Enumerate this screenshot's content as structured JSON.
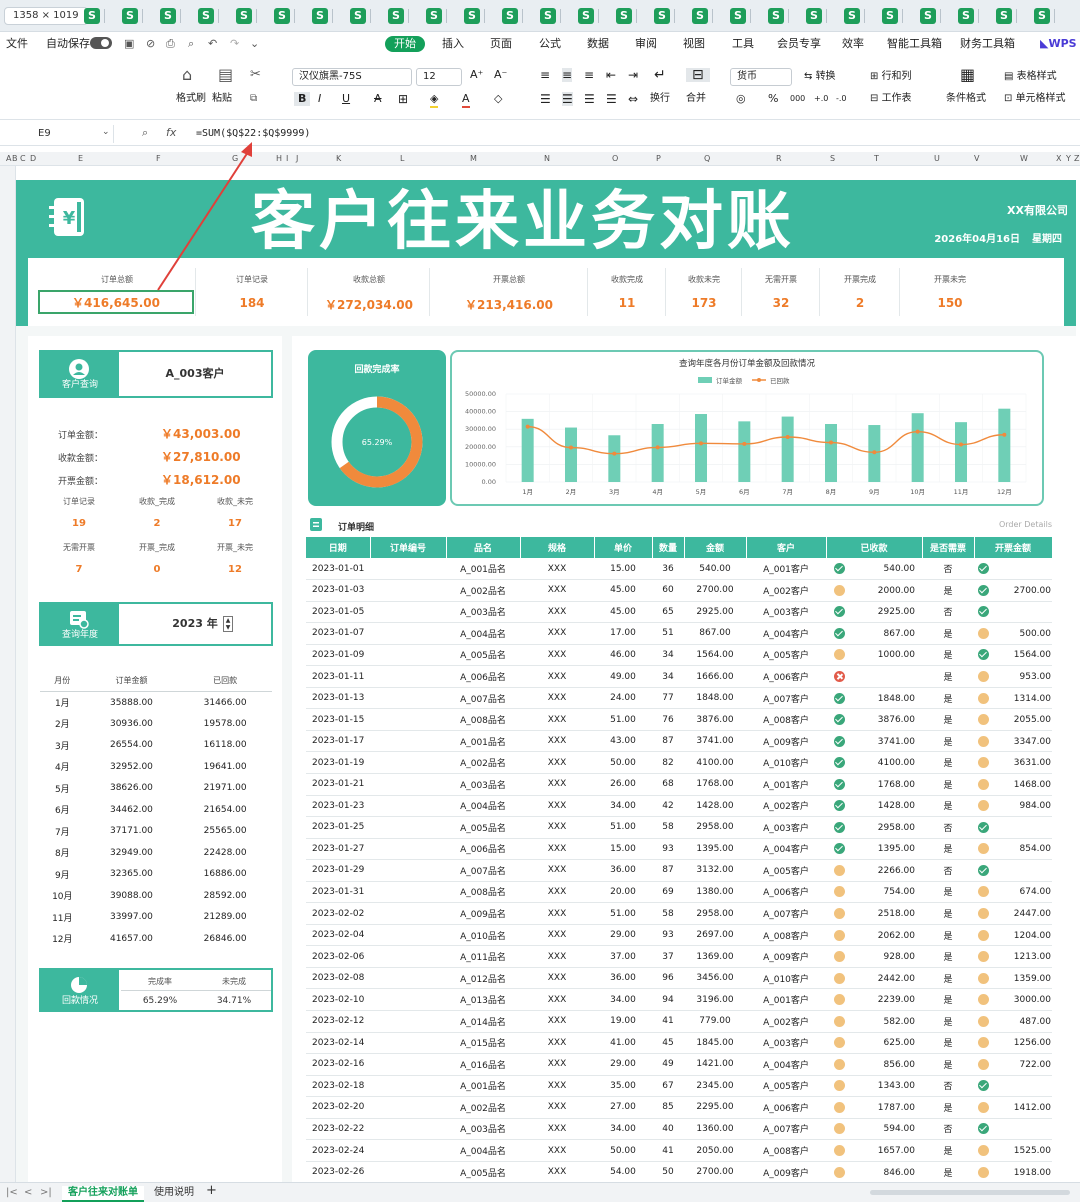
{
  "topbar": {
    "dimensions": "1358 × 1019",
    "sheet_tab_glyph": "S",
    "tab_count": 26
  },
  "menu": {
    "file": "文件",
    "autosave": "自动保存",
    "items": [
      "开始",
      "插入",
      "页面",
      "公式",
      "数据",
      "审阅",
      "视图",
      "工具",
      "会员专享",
      "效率",
      "智能工具箱",
      "财务工具箱"
    ],
    "brand": "WPS"
  },
  "ribbon": {
    "format_painter": "格式刷",
    "paste": "粘贴",
    "font_name": "汉仪旗黑-75S",
    "font_size": "12",
    "wrap": "换行",
    "merge": "合并",
    "number_format": "货币",
    "convert": "转换",
    "row_col": "行和列",
    "worksheet": "工作表",
    "cond_format": "条件格式",
    "table_style": "表格样式",
    "cell_style": "单元格样式"
  },
  "formula": {
    "cell": "E9",
    "fx": "fx",
    "text": "=SUM($Q$22:$Q$9999)"
  },
  "columns": [
    "A",
    "B",
    "C",
    "D",
    "E",
    "F",
    "G",
    "H",
    "I",
    "J",
    "K",
    "L",
    "M",
    "N",
    "O",
    "P",
    "Q",
    "R",
    "S",
    "T",
    "U",
    "V",
    "W",
    "X",
    "Y",
    "Z"
  ],
  "banner": {
    "title": "客户往来业务对账",
    "company": "XX有限公司",
    "date": "2026年04月16日",
    "weekday": "星期四"
  },
  "stats": [
    {
      "label": "订单总额",
      "value": "￥416,645.00"
    },
    {
      "label": "订单记录",
      "value": "184"
    },
    {
      "label": "收款总额",
      "value": "￥272,034.00"
    },
    {
      "label": "开票总额",
      "value": "￥213,416.00"
    },
    {
      "label": "收款完成",
      "value": "11"
    },
    {
      "label": "收款未完",
      "value": "173"
    },
    {
      "label": "无需开票",
      "value": "32"
    },
    {
      "label": "开票完成",
      "value": "2"
    },
    {
      "label": "开票未完",
      "value": "150"
    }
  ],
  "customer": {
    "header": "客户查询",
    "value": "A_003客户",
    "order_label": "订单金额：",
    "order": "￥43,003.00",
    "recv_label": "收款金额：",
    "recv": "￥27,810.00",
    "inv_label": "开票金额：",
    "inv": "￥18,612.00",
    "mini": [
      {
        "label": "订单记录",
        "value": "19"
      },
      {
        "label": "收款_完成",
        "value": "2"
      },
      {
        "label": "收款_未完",
        "value": "17"
      },
      {
        "label": "无需开票",
        "value": "7"
      },
      {
        "label": "开票_完成",
        "value": "0"
      },
      {
        "label": "开票_未完",
        "value": "12"
      }
    ]
  },
  "year": {
    "header": "查询年度",
    "value": "2023 年"
  },
  "monthly": {
    "headers": [
      "月份",
      "订单金额",
      "已回款"
    ],
    "rows": [
      [
        "1月",
        "35888.00",
        "31466.00"
      ],
      [
        "2月",
        "30936.00",
        "19578.00"
      ],
      [
        "3月",
        "26554.00",
        "16118.00"
      ],
      [
        "4月",
        "32952.00",
        "19641.00"
      ],
      [
        "5月",
        "38626.00",
        "21971.00"
      ],
      [
        "6月",
        "34462.00",
        "21654.00"
      ],
      [
        "7月",
        "37171.00",
        "25565.00"
      ],
      [
        "8月",
        "32949.00",
        "22428.00"
      ],
      [
        "9月",
        "32365.00",
        "16886.00"
      ],
      [
        "10月",
        "39088.00",
        "28592.00"
      ],
      [
        "11月",
        "33997.00",
        "21289.00"
      ],
      [
        "12月",
        "41657.00",
        "26846.00"
      ]
    ]
  },
  "payback": {
    "header": "回款情况",
    "headers": [
      "完成率",
      "未完成"
    ],
    "values": [
      "65.29%",
      "34.71%"
    ]
  },
  "donut": {
    "title": "回款完成率",
    "label": "65.29%",
    "fraction": 0.6529,
    "color_done": "#f08a3c",
    "color_rest": "#ffffff"
  },
  "chart_data": {
    "type": "bar",
    "title": "查询年度各月份订单金额及回款情况",
    "categories": [
      "1月",
      "2月",
      "3月",
      "4月",
      "5月",
      "6月",
      "7月",
      "8月",
      "9月",
      "10月",
      "11月",
      "12月"
    ],
    "series": [
      {
        "name": "订单金额",
        "type": "bar",
        "color": "#6fcfb6",
        "values": [
          35888,
          30936,
          26554,
          32952,
          38626,
          34462,
          37171,
          32949,
          32365,
          39088,
          33997,
          41657
        ]
      },
      {
        "name": "已回款",
        "type": "line",
        "color": "#f08a3c",
        "values": [
          31466,
          19578,
          16118,
          19641,
          21971,
          21654,
          25565,
          22428,
          16886,
          28592,
          21289,
          26846
        ]
      }
    ],
    "yticks": [
      "50000.00",
      "40000.00",
      "30000.00",
      "20000.00",
      "10000.00",
      "0.00"
    ],
    "ylim": [
      0,
      50000
    ],
    "legend": "top",
    "grid": true
  },
  "orders": {
    "title": "订单明细",
    "subtitle": "Order  Details",
    "headers": [
      "日期",
      "订单编号",
      "品名",
      "规格",
      "单价",
      "数量",
      "金额",
      "客户",
      "已收款",
      "是否需票",
      "开票金额"
    ],
    "rows": [
      [
        "2023-01-01",
        "",
        "A_001品名",
        "XXX",
        "15.00",
        "36",
        "540.00",
        "A_001客户",
        "ok",
        "540.00",
        "否",
        "ok",
        ""
      ],
      [
        "2023-01-03",
        "",
        "A_002品名",
        "XXX",
        "45.00",
        "60",
        "2700.00",
        "A_002客户",
        "pend",
        "2000.00",
        "是",
        "ok",
        "2700.00"
      ],
      [
        "2023-01-05",
        "",
        "A_003品名",
        "XXX",
        "45.00",
        "65",
        "2925.00",
        "A_003客户",
        "ok",
        "2925.00",
        "否",
        "ok",
        ""
      ],
      [
        "2023-01-07",
        "",
        "A_004品名",
        "XXX",
        "17.00",
        "51",
        "867.00",
        "A_004客户",
        "ok",
        "867.00",
        "是",
        "pend",
        "500.00"
      ],
      [
        "2023-01-09",
        "",
        "A_005品名",
        "XXX",
        "46.00",
        "34",
        "1564.00",
        "A_005客户",
        "pend",
        "1000.00",
        "是",
        "ok",
        "1564.00"
      ],
      [
        "2023-01-11",
        "",
        "A_006品名",
        "XXX",
        "49.00",
        "34",
        "1666.00",
        "A_006客户",
        "bad",
        "",
        "是",
        "pend",
        "953.00"
      ],
      [
        "2023-01-13",
        "",
        "A_007品名",
        "XXX",
        "24.00",
        "77",
        "1848.00",
        "A_007客户",
        "ok",
        "1848.00",
        "是",
        "pend",
        "1314.00"
      ],
      [
        "2023-01-15",
        "",
        "A_008品名",
        "XXX",
        "51.00",
        "76",
        "3876.00",
        "A_008客户",
        "ok",
        "3876.00",
        "是",
        "pend",
        "2055.00"
      ],
      [
        "2023-01-17",
        "",
        "A_001品名",
        "XXX",
        "43.00",
        "87",
        "3741.00",
        "A_009客户",
        "ok",
        "3741.00",
        "是",
        "pend",
        "3347.00"
      ],
      [
        "2023-01-19",
        "",
        "A_002品名",
        "XXX",
        "50.00",
        "82",
        "4100.00",
        "A_010客户",
        "ok",
        "4100.00",
        "是",
        "pend",
        "3631.00"
      ],
      [
        "2023-01-21",
        "",
        "A_003品名",
        "XXX",
        "26.00",
        "68",
        "1768.00",
        "A_001客户",
        "ok",
        "1768.00",
        "是",
        "pend",
        "1468.00"
      ],
      [
        "2023-01-23",
        "",
        "A_004品名",
        "XXX",
        "34.00",
        "42",
        "1428.00",
        "A_002客户",
        "ok",
        "1428.00",
        "是",
        "pend",
        "984.00"
      ],
      [
        "2023-01-25",
        "",
        "A_005品名",
        "XXX",
        "51.00",
        "58",
        "2958.00",
        "A_003客户",
        "ok",
        "2958.00",
        "否",
        "ok",
        ""
      ],
      [
        "2023-01-27",
        "",
        "A_006品名",
        "XXX",
        "15.00",
        "93",
        "1395.00",
        "A_004客户",
        "ok",
        "1395.00",
        "是",
        "pend",
        "854.00"
      ],
      [
        "2023-01-29",
        "",
        "A_007品名",
        "XXX",
        "36.00",
        "87",
        "3132.00",
        "A_005客户",
        "pend",
        "2266.00",
        "否",
        "ok",
        ""
      ],
      [
        "2023-01-31",
        "",
        "A_008品名",
        "XXX",
        "20.00",
        "69",
        "1380.00",
        "A_006客户",
        "pend",
        "754.00",
        "是",
        "pend",
        "674.00"
      ],
      [
        "2023-02-02",
        "",
        "A_009品名",
        "XXX",
        "51.00",
        "58",
        "2958.00",
        "A_007客户",
        "pend",
        "2518.00",
        "是",
        "pend",
        "2447.00"
      ],
      [
        "2023-02-04",
        "",
        "A_010品名",
        "XXX",
        "29.00",
        "93",
        "2697.00",
        "A_008客户",
        "pend",
        "2062.00",
        "是",
        "pend",
        "1204.00"
      ],
      [
        "2023-02-06",
        "",
        "A_011品名",
        "XXX",
        "37.00",
        "37",
        "1369.00",
        "A_009客户",
        "pend",
        "928.00",
        "是",
        "pend",
        "1213.00"
      ],
      [
        "2023-02-08",
        "",
        "A_012品名",
        "XXX",
        "36.00",
        "96",
        "3456.00",
        "A_010客户",
        "pend",
        "2442.00",
        "是",
        "pend",
        "1359.00"
      ],
      [
        "2023-02-10",
        "",
        "A_013品名",
        "XXX",
        "34.00",
        "94",
        "3196.00",
        "A_001客户",
        "pend",
        "2239.00",
        "是",
        "pend",
        "3000.00"
      ],
      [
        "2023-02-12",
        "",
        "A_014品名",
        "XXX",
        "19.00",
        "41",
        "779.00",
        "A_002客户",
        "pend",
        "582.00",
        "是",
        "pend",
        "487.00"
      ],
      [
        "2023-02-14",
        "",
        "A_015品名",
        "XXX",
        "41.00",
        "45",
        "1845.00",
        "A_003客户",
        "pend",
        "625.00",
        "是",
        "pend",
        "1256.00"
      ],
      [
        "2023-02-16",
        "",
        "A_016品名",
        "XXX",
        "29.00",
        "49",
        "1421.00",
        "A_004客户",
        "pend",
        "856.00",
        "是",
        "pend",
        "722.00"
      ],
      [
        "2023-02-18",
        "",
        "A_001品名",
        "XXX",
        "35.00",
        "67",
        "2345.00",
        "A_005客户",
        "pend",
        "1343.00",
        "否",
        "ok",
        ""
      ],
      [
        "2023-02-20",
        "",
        "A_002品名",
        "XXX",
        "27.00",
        "85",
        "2295.00",
        "A_006客户",
        "pend",
        "1787.00",
        "是",
        "pend",
        "1412.00"
      ],
      [
        "2023-02-22",
        "",
        "A_003品名",
        "XXX",
        "34.00",
        "40",
        "1360.00",
        "A_007客户",
        "pend",
        "594.00",
        "否",
        "ok",
        ""
      ],
      [
        "2023-02-24",
        "",
        "A_004品名",
        "XXX",
        "50.00",
        "41",
        "2050.00",
        "A_008客户",
        "pend",
        "1657.00",
        "是",
        "pend",
        "1525.00"
      ],
      [
        "2023-02-26",
        "",
        "A_005品名",
        "XXX",
        "54.00",
        "50",
        "2700.00",
        "A_009客户",
        "pend",
        "846.00",
        "是",
        "pend",
        "1918.00"
      ]
    ]
  },
  "sheets": [
    "客户往来对账单",
    "使用说明"
  ],
  "colors": {
    "teal": "#3db89e",
    "orange": "#ee7b28",
    "arrow": "#e0403a"
  }
}
